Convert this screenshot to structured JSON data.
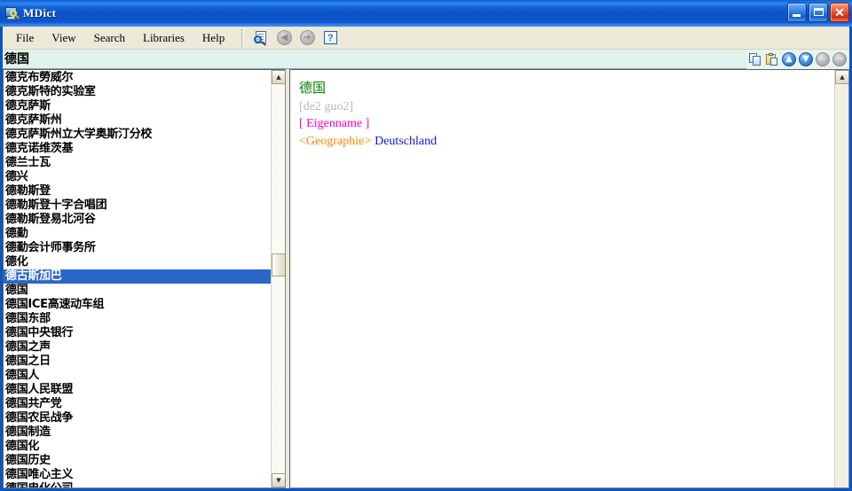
{
  "window": {
    "title": "MDict",
    "icon": "dictionary-magnifier-icon",
    "minimize_label": "Minimize",
    "maximize_label": "Maximize",
    "close_label": "Close",
    "titlebar_color": "#0b55c4"
  },
  "menubar": {
    "items": [
      {
        "label": "File",
        "name": "menu-file"
      },
      {
        "label": "View",
        "name": "menu-view"
      },
      {
        "label": "Search",
        "name": "menu-search"
      },
      {
        "label": "Libraries",
        "name": "menu-libraries"
      },
      {
        "label": "Help",
        "name": "menu-help"
      }
    ],
    "toolbar": [
      {
        "name": "search-document-button",
        "icon": "search-document-icon",
        "enabled": true
      },
      {
        "name": "back-button",
        "icon": "back-arrow-icon",
        "glyph": "◀",
        "enabled": false
      },
      {
        "name": "forward-button",
        "icon": "forward-arrow-icon",
        "glyph": "➜",
        "enabled": false
      },
      {
        "name": "help-button",
        "icon": "question-mark-icon",
        "glyph": "?",
        "enabled": true
      }
    ]
  },
  "search": {
    "value": "德国",
    "placeholder": "",
    "background_color": "#dff3ec",
    "tools": [
      {
        "name": "copy-button",
        "icon": "copy-icon",
        "enabled": true
      },
      {
        "name": "paste-button",
        "icon": "paste-icon",
        "enabled": true
      },
      {
        "name": "scroll-up-button",
        "icon": "up-arrow-icon",
        "glyph": "▲",
        "enabled": true
      },
      {
        "name": "scroll-down-button",
        "icon": "down-arrow-icon",
        "glyph": "▼",
        "enabled": true
      },
      {
        "name": "history-back-button",
        "icon": "left-arrow-icon",
        "glyph": "←",
        "enabled": false
      },
      {
        "name": "history-forward-button",
        "icon": "right-arrow-icon",
        "glyph": "→",
        "enabled": false
      }
    ]
  },
  "wordlist": {
    "selected_index": 14,
    "selection_color": "#2a66c8",
    "entries": [
      "德克布勞威尔",
      "德克斯特的实验室",
      "德克萨斯",
      "德克萨斯州",
      "德克萨斯州立大学奥斯汀分校",
      "德克诺维茨基",
      "德兰士瓦",
      "德兴",
      "德勒斯登",
      "德勒斯登十字合唱团",
      "德勒斯登易北河谷",
      "德勤",
      "德勤会计师事务所",
      "德化",
      "德古斯加巴",
      "德国",
      "德国ICE高速动车组",
      "德国东部",
      "德国中央银行",
      "德国之声",
      "德国之日",
      "德国人",
      "德国人民联盟",
      "德国共产党",
      "德国农民战争",
      "德国制造",
      "德国化",
      "德国历史",
      "德国唯心主义",
      "德国电化公司"
    ],
    "scrollbar": {
      "up_glyph": "▲",
      "down_glyph": "▼",
      "thumb_top_pct": 43.5,
      "thumb_height_pct": 6.0
    }
  },
  "definition": {
    "headword": "德国",
    "headword_color": "#008000",
    "pinyin": "[de2 guo2]",
    "pinyin_color": "#b8b8b8",
    "category": "[ Eigenname ]",
    "category_color": "#ff00c8",
    "field_tag": "<Geographie>",
    "field_tag_color": "#ff8800",
    "translation": "Deutschland",
    "translation_color": "#1414d2",
    "scrollbar": {
      "up_glyph": "▲"
    }
  }
}
